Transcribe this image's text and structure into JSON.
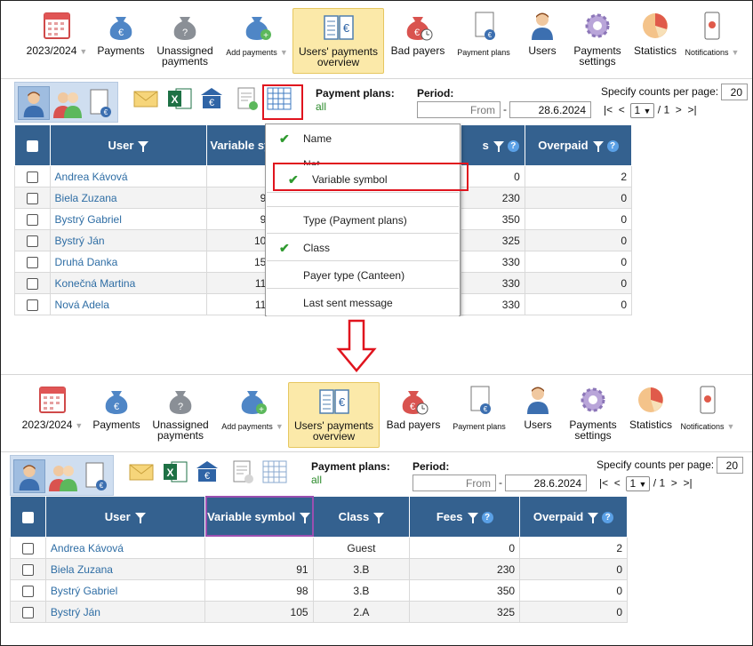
{
  "toolbar": {
    "year": "2023/2024",
    "items": [
      {
        "label": "Payments",
        "icon": "money-bag-euro-icon"
      },
      {
        "label": "Unassigned payments",
        "icon": "money-bag-question-icon"
      },
      {
        "label": "Add payments",
        "icon": "money-bag-add-icon"
      },
      {
        "label": "Users' payments overview",
        "icon": "ledger-euro-icon"
      },
      {
        "label": "Bad payers",
        "icon": "money-bag-clock-icon"
      },
      {
        "label": "Payment plans",
        "icon": "document-euro-icon"
      },
      {
        "label": "Users",
        "icon": "user-icon"
      },
      {
        "label": "Payments settings",
        "icon": "gear-icon"
      },
      {
        "label": "Statistics",
        "icon": "pie-chart-icon"
      },
      {
        "label": "Notifications",
        "icon": "phone-notification-icon"
      }
    ]
  },
  "filters": {
    "payment_plans_label": "Payment plans:",
    "payment_plans_value": "all",
    "period_label": "Period:",
    "from_placeholder": "From",
    "to_value": "28.6.2024",
    "counts_label": "Specify counts per page:",
    "counts_value": "20",
    "pager_first": "|<",
    "pager_prev": "<",
    "page_value": "1",
    "page_total": "/ 1",
    "pager_next": ">",
    "pager_last": ">|"
  },
  "top_table": {
    "headers": {
      "user": "User",
      "vs": "Variable sy",
      "fees": "s",
      "overpaid": "Overpaid"
    },
    "rows": [
      {
        "name": "Andrea Kávová",
        "vs": "",
        "fees": "0",
        "overpaid": "2"
      },
      {
        "name": "Biela Zuzana",
        "vs": "9",
        "fees": "230",
        "overpaid": "0"
      },
      {
        "name": "Bystrý Gabriel",
        "vs": "9",
        "fees": "350",
        "overpaid": "0"
      },
      {
        "name": "Bystrý Ján",
        "vs": "10",
        "fees": "325",
        "overpaid": "0"
      },
      {
        "name": "Druhá Danka",
        "vs": "15",
        "fees": "330",
        "overpaid": "0"
      },
      {
        "name": "Konečná Martina",
        "vs": "11",
        "fees": "330",
        "overpaid": "0"
      },
      {
        "name": "Nová Adela",
        "vs": "11",
        "fees": "330",
        "overpaid": "0"
      }
    ]
  },
  "dropdown": {
    "items": [
      {
        "label": "Name",
        "checked": true
      },
      {
        "label": "Nat",
        "checked": false
      },
      {
        "label": "Variable symbol",
        "checked": true
      },
      {
        "label": "",
        "checked": false
      },
      {
        "label": "Type (Payment plans)",
        "checked": false
      },
      {
        "label": "Class",
        "checked": true
      },
      {
        "label": "Payer type (Canteen)",
        "checked": false
      },
      {
        "label": "Last sent message",
        "checked": false
      }
    ],
    "checkmark": "✔"
  },
  "bottom_table": {
    "headers": {
      "user": "User",
      "vs": "Variable symbol",
      "class": "Class",
      "fees": "Fees",
      "overpaid": "Overpaid"
    },
    "rows": [
      {
        "name": "Andrea Kávová",
        "vs": "",
        "class": "Guest",
        "fees": "0",
        "overpaid": "2"
      },
      {
        "name": "Biela Zuzana",
        "vs": "91",
        "class": "3.B",
        "fees": "230",
        "overpaid": "0"
      },
      {
        "name": "Bystrý Gabriel",
        "vs": "98",
        "class": "3.B",
        "fees": "350",
        "overpaid": "0"
      },
      {
        "name": "Bystrý Ján",
        "vs": "105",
        "class": "2.A",
        "fees": "325",
        "overpaid": "0"
      }
    ]
  },
  "colors": {
    "header_blue": "#34618f",
    "highlight_red": "#e0141e",
    "highlight_purple": "#9b4fb0",
    "active_tab": "#fbe9a9"
  }
}
